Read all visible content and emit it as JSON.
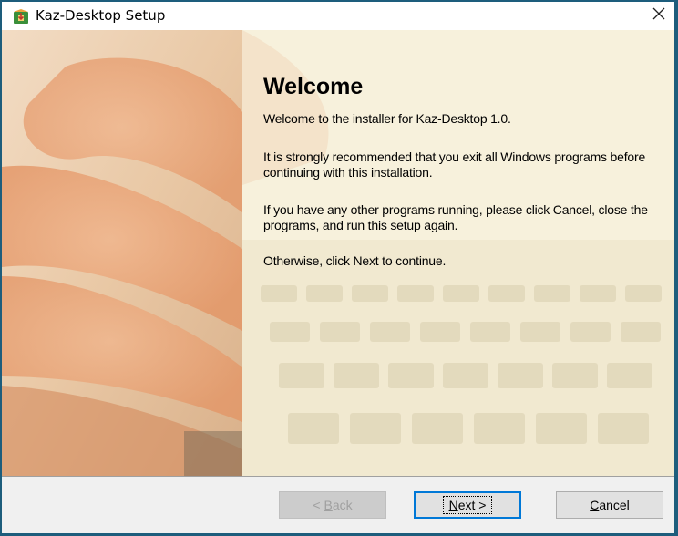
{
  "window": {
    "title": "Kaz-Desktop Setup",
    "app_icon": "installer-icon",
    "close_icon": "close-icon"
  },
  "welcome": {
    "heading": "Welcome",
    "paragraphs": [
      "Welcome to the installer for Kaz-Desktop 1.0.",
      "It is strongly recommended that you exit all Windows programs before continuing with this installation.",
      "If you have any other programs running, please click Cancel, close the programs, and run this setup again.",
      "Otherwise, click Next to continue."
    ]
  },
  "buttons": {
    "back": {
      "label_access": "B",
      "label_rest": "ack",
      "label_prefix": "< ",
      "enabled": false
    },
    "next": {
      "label_access": "N",
      "label_rest": "ext >",
      "enabled": true,
      "default": true
    },
    "cancel": {
      "label_access": "C",
      "label_rest": "ancel",
      "enabled": true
    }
  },
  "colors": {
    "frame": "#1d5d7c",
    "content_bg": "#f7f1dc",
    "footer_bg": "#f0f0f0",
    "default_button_border": "#0078d7"
  }
}
